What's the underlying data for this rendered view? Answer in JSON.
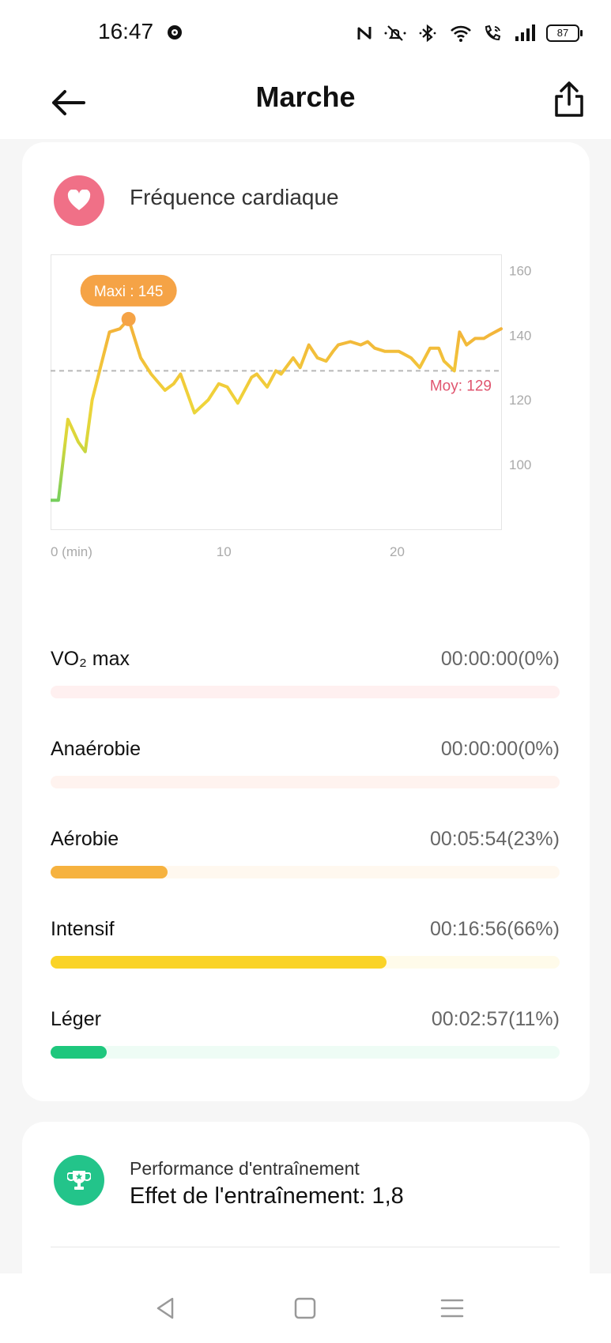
{
  "status_bar": {
    "time": "16:47",
    "battery": "87",
    "icons": [
      "nfc-icon",
      "mute-icon",
      "bluetooth-icon",
      "wifi-icon",
      "wifi-call-icon",
      "signal-icon",
      "battery-icon"
    ]
  },
  "app_bar": {
    "title": "Marche",
    "back_icon": "arrow-left-icon",
    "share_icon": "share-icon"
  },
  "heart_rate": {
    "title": "Fréquence cardiaque",
    "icon": "heart-icon",
    "icon_color": "#f07087"
  },
  "chart_data": {
    "type": "line",
    "title": "",
    "xlabel": "(min)",
    "ylabel": "",
    "x_ticks": [
      {
        "value": 0,
        "label": "0 (min)"
      },
      {
        "value": 10,
        "label": "10"
      },
      {
        "value": 20,
        "label": "20"
      }
    ],
    "y_ticks": [
      100,
      120,
      140,
      160
    ],
    "xlim": [
      0,
      26
    ],
    "ylim": [
      80,
      165
    ],
    "max_label": "Maxi : 145",
    "max_point": {
      "x": 4.5,
      "y": 145
    },
    "avg_label": "Moy: 129",
    "avg": 129,
    "colors": {
      "low": "#1ec77d",
      "mid": "#f0d43a",
      "high": "#f4b63a",
      "max_badge": "#f5a346",
      "avg_label": "#e0556f"
    },
    "series": [
      {
        "x": [
          0,
          0.45,
          1.0,
          1.6,
          2.0,
          2.4,
          3.4,
          4.0,
          4.5,
          5.2,
          5.8,
          6.6,
          7.1,
          7.5,
          8.3,
          8.7,
          9.1,
          9.7,
          10.2,
          10.8,
          11.6,
          11.9,
          12.5,
          13.0,
          13.3,
          14.0,
          14.4,
          14.9,
          15.4,
          15.9,
          16.3,
          16.6,
          17.3,
          17.9,
          18.3,
          18.7,
          19.3,
          20.1,
          20.8,
          21.3,
          21.9,
          22.4,
          22.7,
          23.3,
          23.6,
          24.0,
          24.5,
          25.0,
          25.3,
          26.0
        ],
        "y": [
          89,
          89,
          114,
          107,
          104,
          120,
          141,
          142,
          145,
          133,
          128,
          123,
          125,
          128,
          116,
          118,
          120,
          125,
          124,
          119,
          127,
          128,
          124,
          129,
          128,
          133,
          130,
          137,
          133,
          132,
          135,
          137,
          138,
          137,
          138,
          136,
          135,
          135,
          133,
          130,
          136,
          136,
          132,
          129,
          141,
          137,
          139,
          139,
          140,
          142
        ]
      }
    ]
  },
  "zones": [
    {
      "label": "VO₂ max",
      "value": "00:00:00(0%)",
      "percent": 0,
      "color": "#f26d7d",
      "track": "#fff0f0"
    },
    {
      "label": "Anaérobie",
      "value": "00:00:00(0%)",
      "percent": 0,
      "color": "#f58a5a",
      "track": "#fff3ef"
    },
    {
      "label": "Aérobie",
      "value": "00:05:54(23%)",
      "percent": 23,
      "color": "#f6b23f",
      "track": "#fff8ef"
    },
    {
      "label": "Intensif",
      "value": "00:16:56(66%)",
      "percent": 66,
      "color": "#fad327",
      "track": "#fffbea"
    },
    {
      "label": "Léger",
      "value": "00:02:57(11%)",
      "percent": 11,
      "color": "#1ec77d",
      "track": "#eefcf5"
    }
  ],
  "performance": {
    "label": "Performance d'entraînement",
    "value": "Effet de l'entraînement: 1,8",
    "icon": "trophy-icon",
    "icon_color": "#23c48a"
  },
  "nav_bar": {
    "items": [
      "back-nav-icon",
      "home-nav-icon",
      "menu-nav-icon"
    ]
  }
}
